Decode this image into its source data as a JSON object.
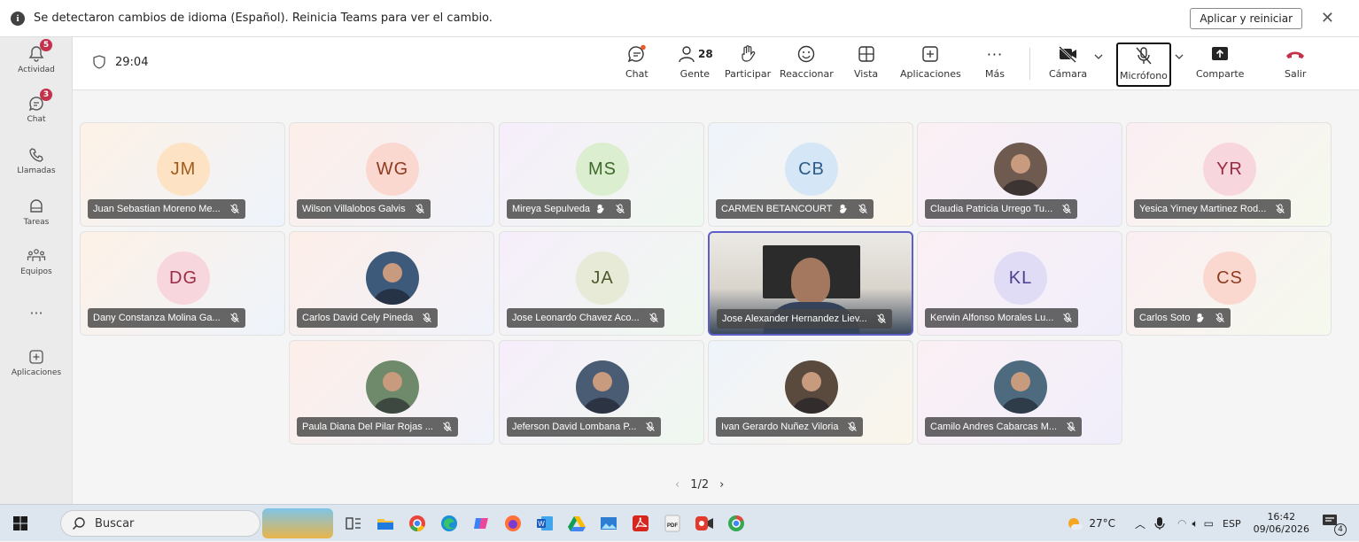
{
  "banner": {
    "message": "Se detectaron cambios de idioma (Español). Reinicia Teams para ver el cambio.",
    "apply_label": "Aplicar y reiniciar"
  },
  "rail": {
    "items": [
      {
        "label": "Actividad",
        "icon": "bell-icon",
        "badge": "5"
      },
      {
        "label": "Chat",
        "icon": "chat-icon",
        "badge": "3"
      },
      {
        "label": "Llamadas",
        "icon": "phone-icon",
        "badge": ""
      },
      {
        "label": "Tareas",
        "icon": "tasks-icon",
        "badge": ""
      },
      {
        "label": "Equipos",
        "icon": "teams-icon",
        "badge": ""
      },
      {
        "label": "Aplicaciones",
        "icon": "add-apps-icon",
        "badge": ""
      }
    ]
  },
  "meeting": {
    "timer": "29:04",
    "people_count": "28",
    "toolbar": {
      "chat": "Chat",
      "people": "Gente",
      "raise": "Participar",
      "react": "Reaccionar",
      "view": "Vista",
      "apps": "Aplicaciones",
      "more": "Más",
      "camera": "Cámara",
      "mic": "Micrófono",
      "share": "Comparte",
      "leave": "Salir"
    }
  },
  "participants": [
    {
      "initials": "JM",
      "name": "Juan Sebastian Moreno Me...",
      "avatar_color": "#fde2c4",
      "initials_color": "#a25c1a",
      "photo": false,
      "hand": false
    },
    {
      "initials": "WG",
      "name": "Wilson Villalobos Galvis",
      "avatar_color": "#fbd8cf",
      "initials_color": "#8e3b21",
      "photo": false,
      "hand": false
    },
    {
      "initials": "MS",
      "name": "Mireya Sepulveda",
      "avatar_color": "#dbeecf",
      "initials_color": "#3e6b2a",
      "photo": false,
      "hand": true
    },
    {
      "initials": "CB",
      "name": "CARMEN BETANCOURT",
      "avatar_color": "#d5e6f6",
      "initials_color": "#2b5b8a",
      "photo": false,
      "hand": true
    },
    {
      "initials": "",
      "name": "Claudia Patricia Urrego Tu...",
      "avatar_color": "#6e5a4e",
      "initials_color": "#ffffff",
      "photo": true,
      "hand": false
    },
    {
      "initials": "YR",
      "name": "Yesica Yirney Martinez Rod...",
      "avatar_color": "#f8d6dd",
      "initials_color": "#9b2b43",
      "photo": false,
      "hand": false
    },
    {
      "initials": "DG",
      "name": "Dany Constanza Molina Ga...",
      "avatar_color": "#f8d6dd",
      "initials_color": "#9b2b43",
      "photo": false,
      "hand": false
    },
    {
      "initials": "",
      "name": "Carlos David Cely Pineda",
      "avatar_color": "#3d5a7a",
      "initials_color": "#ffffff",
      "photo": true,
      "hand": false
    },
    {
      "initials": "JA",
      "name": "Jose Leonardo Chavez Aco...",
      "avatar_color": "#e6ead6",
      "initials_color": "#4e5a2c",
      "photo": false,
      "hand": false
    },
    {
      "initials": "",
      "name": "Jose Alexander Hernandez Liev...",
      "avatar_color": "#8d7a6a",
      "initials_color": "#ffffff",
      "photo": true,
      "hand": false,
      "video": true
    },
    {
      "initials": "KL",
      "name": "Kerwin Alfonso Morales Lu...",
      "avatar_color": "#e0dcf5",
      "initials_color": "#4a3f8c",
      "photo": false,
      "hand": false
    },
    {
      "initials": "CS",
      "name": "Carlos Soto",
      "avatar_color": "#fbd8cf",
      "initials_color": "#8e3b21",
      "photo": false,
      "hand": true
    },
    {
      "initials": "",
      "name": "Paula Diana Del Pilar Rojas ...",
      "avatar_color": "#6f8a6a",
      "initials_color": "#ffffff",
      "photo": true,
      "hand": false
    },
    {
      "initials": "",
      "name": "Jeferson David Lombana P...",
      "avatar_color": "#4a5c74",
      "initials_color": "#ffffff",
      "photo": true,
      "hand": false
    },
    {
      "initials": "",
      "name": "Ivan Gerardo Nuñez Viloria",
      "avatar_color": "#5a4a3e",
      "initials_color": "#ffffff",
      "photo": true,
      "hand": false
    },
    {
      "initials": "",
      "name": "Camilo Andres Cabarcas M...",
      "avatar_color": "#4e6a7e",
      "initials_color": "#ffffff",
      "photo": true,
      "hand": false
    }
  ],
  "pager": {
    "label": "1/2"
  },
  "taskbar": {
    "search_placeholder": "Buscar",
    "weather": "27°C",
    "language": "ESP",
    "time": "16:42",
    "date": "09/06/2026",
    "notifications": "4"
  },
  "colors": {
    "accent": "#5b5fc7",
    "leave": "#c4314b",
    "badge": "#c4314b"
  }
}
